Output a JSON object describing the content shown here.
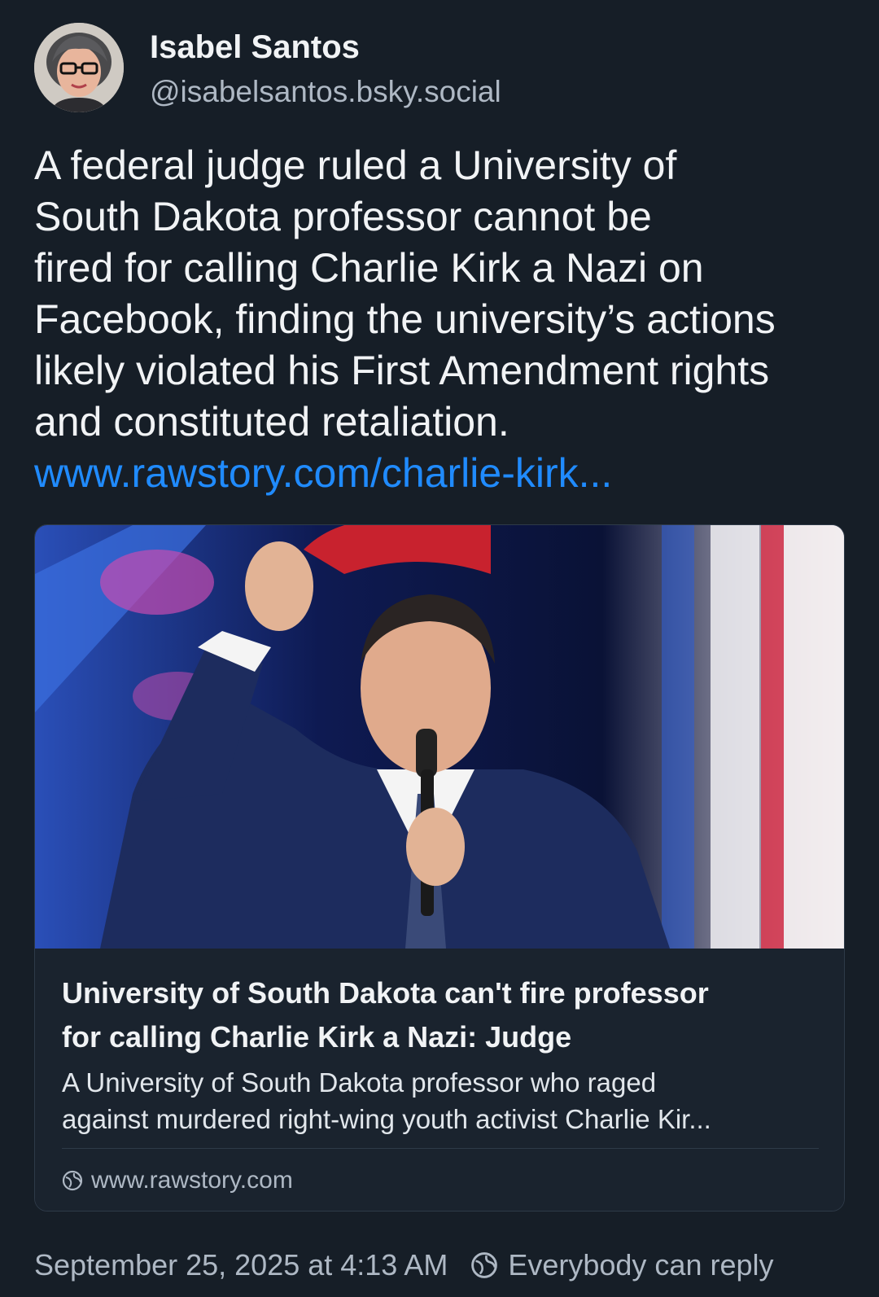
{
  "author": {
    "display_name": "Isabel Santos",
    "handle": "@isabelsantos.bsky.social"
  },
  "post": {
    "text_lines": [
      "A federal judge ruled a University of",
      "South Dakota professor cannot be",
      "fired for calling Charlie Kirk a Nazi on",
      "Facebook, finding the university’s actions",
      "likely violated his First Amendment rights",
      "and constituted retaliation."
    ],
    "link_text": "www.rawstory.com/charlie-kirk..."
  },
  "link_card": {
    "title_lines": [
      "University of South Dakota can't fire professor",
      "for calling Charlie Kirk a Nazi: Judge"
    ],
    "description_lines": [
      "A University of South Dakota professor who raged",
      "against murdered right-wing youth activist Charlie Kir..."
    ],
    "domain": "www.rawstory.com",
    "domain_icon": "globe-icon",
    "image_icon": "article-photo"
  },
  "footer": {
    "timestamp": "September 25, 2025 at 4:13 AM",
    "reply_setting": "Everybody can reply",
    "reply_icon": "globe-icon"
  },
  "colors": {
    "background": "#161e27",
    "link": "#208bfe",
    "secondary_text": "#aeb8c4"
  }
}
